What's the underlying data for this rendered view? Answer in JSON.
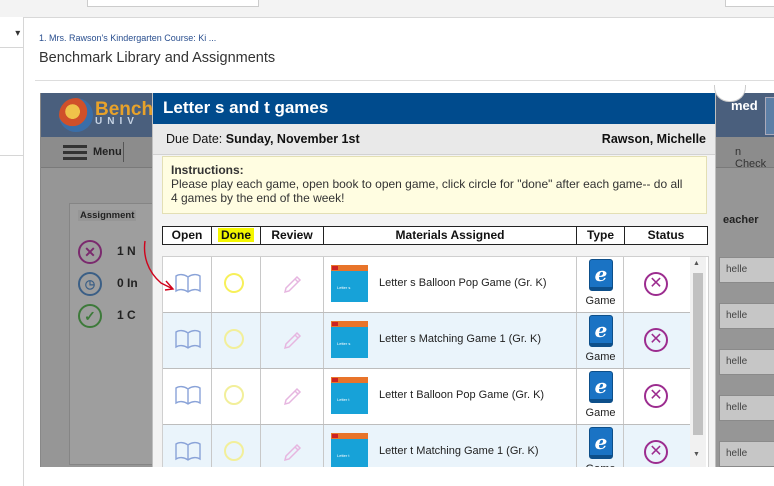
{
  "breadcrumb": "1. Mrs. Rawson's Kindergarten Course: Ki ...",
  "page_title": "Benchmark Library and Assignments",
  "background": {
    "brand": "Bench",
    "brand_sub": "UNIV",
    "header_right": "med",
    "menu_label": "Menu",
    "check_label": "n Check",
    "assignments_label": "Assignment",
    "status_counts": [
      {
        "count": "1 N",
        "icon": "x-circle-icon"
      },
      {
        "count": "0 In",
        "icon": "clock-icon"
      },
      {
        "count": "1 C",
        "icon": "check-circle-icon"
      }
    ],
    "teacher_label": "eacher",
    "row_buttons": [
      "helle",
      "helle",
      "helle",
      "helle",
      "helle"
    ]
  },
  "modal": {
    "title": "Letter s and t games",
    "due_label": "Due Date:",
    "due_date": "Sunday, November 1st",
    "teacher": "Rawson, Michelle",
    "instructions_title": "Instructions:",
    "instructions_text": "Please play each game, open book to open game, click circle for \"done\" after each game-- do all 4 games by the end of the week!",
    "columns": [
      "Open",
      "Done",
      "Review",
      "Materials Assigned",
      "Type",
      "Status"
    ],
    "rows": [
      {
        "material": "Letter s Balloon Pop Game (Gr. K)",
        "thumb_text": "Letter s",
        "type": "Game"
      },
      {
        "material": "Letter s Matching Game 1 (Gr. K)",
        "thumb_text": "Letter s",
        "type": "Game"
      },
      {
        "material": "Letter t Balloon Pop Game (Gr. K)",
        "thumb_text": "Letter t",
        "type": "Game"
      },
      {
        "material": "Letter t Matching Game 1 (Gr. K)",
        "thumb_text": "Letter t",
        "type": "Game"
      }
    ]
  },
  "colors": {
    "modal_header": "#004b8d",
    "done_highlight": "#f4f600",
    "status_x": "#9c2c8f",
    "annotation": "#d0021b"
  }
}
